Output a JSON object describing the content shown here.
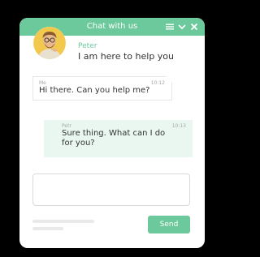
{
  "header": {
    "title": "Chat with us",
    "controls": [
      "menu-icon",
      "minimize-icon",
      "close-icon"
    ]
  },
  "agent": {
    "name": "Peter",
    "status": "I am here to help you"
  },
  "messages": [
    {
      "sender": "Me",
      "time": "10:12",
      "text": "Hi there. Can you help me?",
      "direction": "incoming"
    },
    {
      "sender": "Petr",
      "time": "10:13",
      "text": "Sure thing. What can I do for you?",
      "direction": "outgoing"
    }
  ],
  "composer": {
    "value": "",
    "placeholder": "",
    "send_label": "Send"
  },
  "colors": {
    "accent": "#6cc99c",
    "outgoing_bubble": "#e9f7f0",
    "background": "#000000"
  }
}
